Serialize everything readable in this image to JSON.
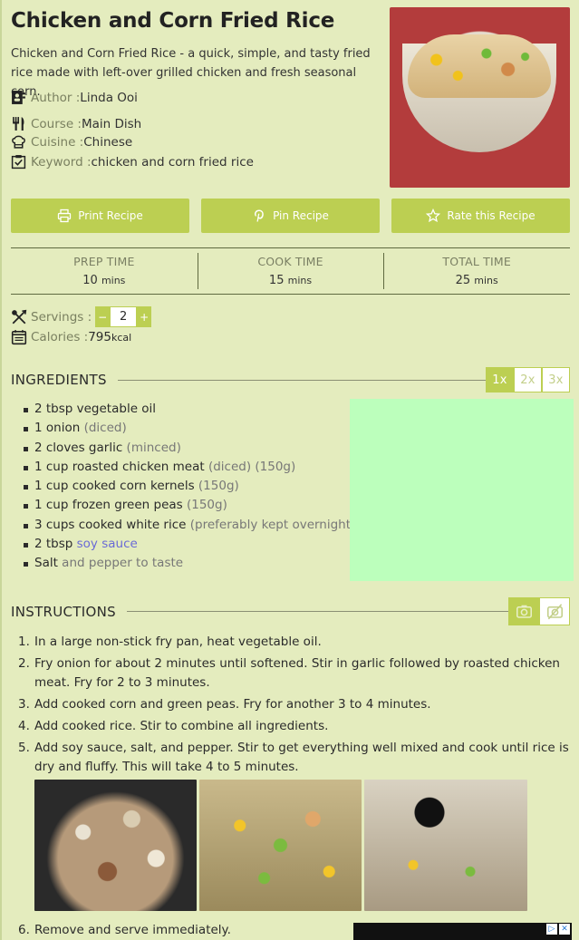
{
  "recipe": {
    "title": "Chicken and Corn Fried Rice",
    "summary": "Chicken and Corn Fried Rice - a quick, simple, and tasty fried rice made with left-over grilled chicken and fresh seasonal corn.",
    "author_label": "Author : ",
    "author": "Linda Ooi",
    "course_label": "Course : ",
    "course": "Main Dish",
    "cuisine_label": "Cuisine : ",
    "cuisine": "Chinese",
    "keyword_label": "Keyword : ",
    "keyword": "chicken and corn fried rice"
  },
  "actions": {
    "print": "Print Recipe",
    "pin": "Pin Recipe",
    "rate": "Rate this Recipe"
  },
  "times": {
    "prep_label": "PREP TIME",
    "prep_value": "10",
    "prep_unit": "mins",
    "cook_label": "COOK TIME",
    "cook_value": "15",
    "cook_unit": "mins",
    "total_label": "TOTAL TIME",
    "total_value": "25",
    "total_unit": "mins"
  },
  "servings": {
    "label": "Servings : ",
    "minus": "−",
    "value": "2",
    "plus": "+"
  },
  "calories": {
    "label": "Calories : ",
    "value": "795",
    "unit": "kcal"
  },
  "ingredients": {
    "heading": "INGREDIENTS",
    "multipliers": [
      "1x",
      "2x",
      "3x"
    ],
    "items": [
      {
        "text": "2 tbsp vegetable oil",
        "note": ""
      },
      {
        "text": "1 onion ",
        "note": "(diced)"
      },
      {
        "text": "2 cloves garlic ",
        "note": "(minced)"
      },
      {
        "text": "1 cup roasted chicken meat ",
        "note": "(diced) (150g)"
      },
      {
        "text": "1 cup cooked corn kernels ",
        "note": "(150g)"
      },
      {
        "text": "1 cup frozen green peas ",
        "note": "(150g)"
      },
      {
        "text": "3 cups cooked white rice ",
        "note": "(preferably kept overnight)"
      },
      {
        "text": "2 tbsp ",
        "link": "soy sauce"
      },
      {
        "text": "Salt",
        "note": " and pepper to taste"
      }
    ]
  },
  "instructions": {
    "heading": "INSTRUCTIONS",
    "steps": [
      {
        "n": "1.",
        "text": "In a large non-stick fry pan, heat vegetable oil."
      },
      {
        "n": "2.",
        "text": "Fry onion for about 2 minutes until softened. Stir in garlic followed by roasted chicken meat. Fry for 2 to 3 minutes."
      },
      {
        "n": "3.",
        "text": "Add cooked corn and green peas. Fry for another 3 to 4 minutes."
      },
      {
        "n": "4.",
        "text": "Add cooked rice. Stir to combine all ingredients."
      },
      {
        "n": "5.",
        "text": "Add soy sauce, salt, and pepper. Stir to get everything well mixed and cook until rice is dry and fluffy. This will take 4 to 5 minutes."
      },
      {
        "n": "6.",
        "text": "Remove and serve immediately."
      }
    ]
  },
  "colors": {
    "accent": "#bccf52",
    "background": "#e4ecbe",
    "ad_placeholder": "#bcffbc"
  }
}
